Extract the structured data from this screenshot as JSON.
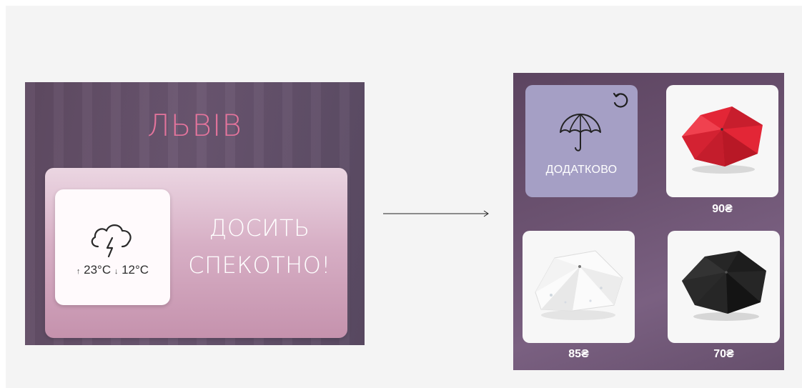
{
  "weather": {
    "city": "ЛЬВІВ",
    "icon": "thunderstorm-icon",
    "temp_high": "23°C",
    "temp_low": "12°C",
    "message_line1": "ДОСИТЬ",
    "message_line2": "СПЕКОТНО!"
  },
  "shop": {
    "extra_tile": {
      "icon": "umbrella-icon",
      "label": "ДОДАТКОВО",
      "action_icon": "refresh-icon"
    },
    "products": [
      {
        "color_name": "red",
        "color": "#e32636",
        "price": "90₴"
      },
      {
        "color_name": "white-floral",
        "color": "#f2f2f2",
        "price": "85₴"
      },
      {
        "color_name": "black",
        "color": "#1c1c1c",
        "price": "70₴"
      }
    ]
  },
  "colors": {
    "city_title": "#e4749c",
    "extra_tile": "#a59fc5",
    "card_top": "#ebd6e2",
    "card_bottom": "#c592ad"
  }
}
